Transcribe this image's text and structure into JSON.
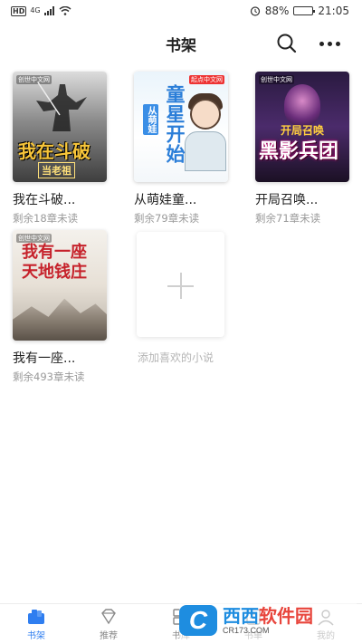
{
  "status_bar": {
    "hd_label": "HD",
    "network": "4G",
    "battery": "88%",
    "battery_level": 0.88,
    "time": "21:05"
  },
  "header": {
    "title": "书架",
    "search_icon": "search-icon",
    "more_icon": "more-icon"
  },
  "books": [
    {
      "title": "我在斗破...",
      "unread": "剩余18章未读",
      "cover_text": "我在斗破",
      "cover_sub": "当老祖",
      "brand": "创世中文网"
    },
    {
      "title": "从萌娃童...",
      "unread": "剩余79章未读",
      "cover_text": "童星开始",
      "cover_sub": "从萌娃",
      "brand": "起点中文网"
    },
    {
      "title": "开局召唤...",
      "unread": "剩余71章未读",
      "cover_text": "黑影兵团",
      "cover_sub": "开局召唤",
      "brand": "创世中文网"
    },
    {
      "title": "我有一座...",
      "unread": "剩余493章未读",
      "cover_text": "我有一座天地钱庄",
      "brand": "创世中文网"
    }
  ],
  "add_book": {
    "label": "添加喜欢的小说"
  },
  "tabs": [
    {
      "label": "书架",
      "icon": "bookshelf-icon",
      "active": true
    },
    {
      "label": "推荐",
      "icon": "diamond-icon",
      "active": false
    },
    {
      "label": "书库",
      "icon": "grid-icon",
      "active": false
    },
    {
      "label": "书单",
      "icon": "list-icon",
      "active": false
    },
    {
      "label": "我的",
      "icon": "profile-icon",
      "active": false
    }
  ],
  "watermark": {
    "logo": "C",
    "name_a": "西西",
    "name_b": "软件园",
    "domain": "CR173.COM"
  },
  "colors": {
    "accent": "#2f7ef0",
    "text_primary": "#222222",
    "text_secondary": "#9a9a9a"
  }
}
